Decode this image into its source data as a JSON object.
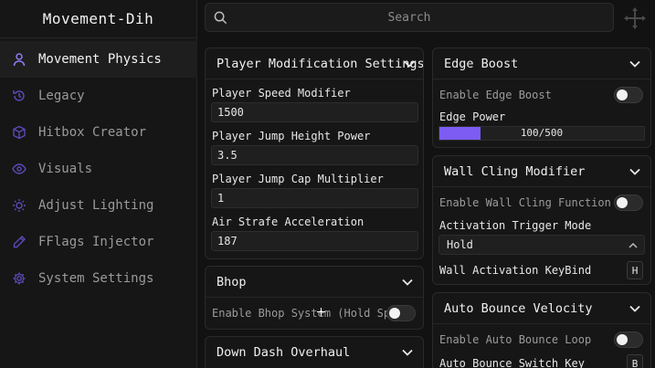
{
  "app": {
    "title": "Movement-Dih"
  },
  "sidebar": {
    "items": [
      {
        "label": "Movement Physics",
        "icon": "person-icon",
        "active": true
      },
      {
        "label": "Legacy",
        "icon": "history-icon",
        "active": false
      },
      {
        "label": "Hitbox Creator",
        "icon": "cube-icon",
        "active": false
      },
      {
        "label": "Visuals",
        "icon": "eye-icon",
        "active": false
      },
      {
        "label": "Adjust Lighting",
        "icon": "sun-icon",
        "active": false
      },
      {
        "label": "FFlags Injector",
        "icon": "pen-icon",
        "active": false
      },
      {
        "label": "System Settings",
        "icon": "gear-icon",
        "active": false
      }
    ]
  },
  "search": {
    "placeholder": "Search"
  },
  "colors": {
    "accent": "#7c5cf2",
    "background": "#121212",
    "panel": "#161616"
  },
  "player_mod": {
    "title": "Player Modification Settings",
    "fields": [
      {
        "label": "Player Speed Modifier",
        "value": "1500"
      },
      {
        "label": "Player Jump Height Power",
        "value": "3.5"
      },
      {
        "label": "Player Jump Cap Multiplier",
        "value": "1"
      },
      {
        "label": "Air Strafe Acceleration",
        "value": "187"
      }
    ]
  },
  "bhop": {
    "title": "Bhop",
    "toggle_label": "Enable Bhop System (Hold Space)",
    "enabled": false
  },
  "down_dash": {
    "title": "Down Dash Overhaul"
  },
  "edge_boost": {
    "title": "Edge Boost",
    "toggle_label": "Enable Edge Boost",
    "enabled": false,
    "power_label": "Edge Power",
    "power_text": "100/500",
    "power_fraction": 0.2
  },
  "wall_cling": {
    "title": "Wall Cling Modifier",
    "toggle_label": "Enable Wall Cling Function",
    "enabled": false,
    "trigger_label": "Activation Trigger Mode",
    "trigger_value": "Hold",
    "keybind_label": "Wall Activation KeyBind",
    "keybind_value": "H"
  },
  "auto_bounce": {
    "title": "Auto Bounce Velocity",
    "toggle_label": "Enable Auto Bounce Loop",
    "enabled": false,
    "switch_label": "Auto Bounce Switch Key",
    "switch_value": "B"
  }
}
